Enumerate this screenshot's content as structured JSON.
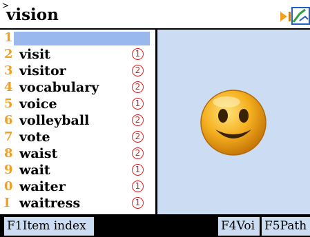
{
  "search": {
    "prompt_mark": ">",
    "text": "vision"
  },
  "icons": {
    "skip": "skip-forward-icon",
    "pen": "pen-icon"
  },
  "word_list": {
    "rows": [
      {
        "num": "1",
        "word": "",
        "freq": ""
      },
      {
        "num": "2",
        "word": "visit",
        "freq": "1"
      },
      {
        "num": "3",
        "word": "visitor",
        "freq": "2"
      },
      {
        "num": "4",
        "word": "vocabulary",
        "freq": "2"
      },
      {
        "num": "5",
        "word": "voice",
        "freq": "1"
      },
      {
        "num": "6",
        "word": "volleyball",
        "freq": "2"
      },
      {
        "num": "7",
        "word": "vote",
        "freq": "2"
      },
      {
        "num": "8",
        "word": "waist",
        "freq": "2"
      },
      {
        "num": "9",
        "word": "wait",
        "freq": "1"
      },
      {
        "num": "0",
        "word": "waiter",
        "freq": "1"
      },
      {
        "num": "I",
        "word": "waitress",
        "freq": "1"
      }
    ]
  },
  "picture": {
    "icon": "smiley-face-icon"
  },
  "function_bar": {
    "f1": "F1Item index",
    "f4": "F4Voi",
    "f5": "F5Path"
  },
  "colors": {
    "number_color": "#f0a020",
    "freq_color": "#e02020",
    "picture_bg": "#ccdcf2",
    "selection": "#98b8ee"
  }
}
